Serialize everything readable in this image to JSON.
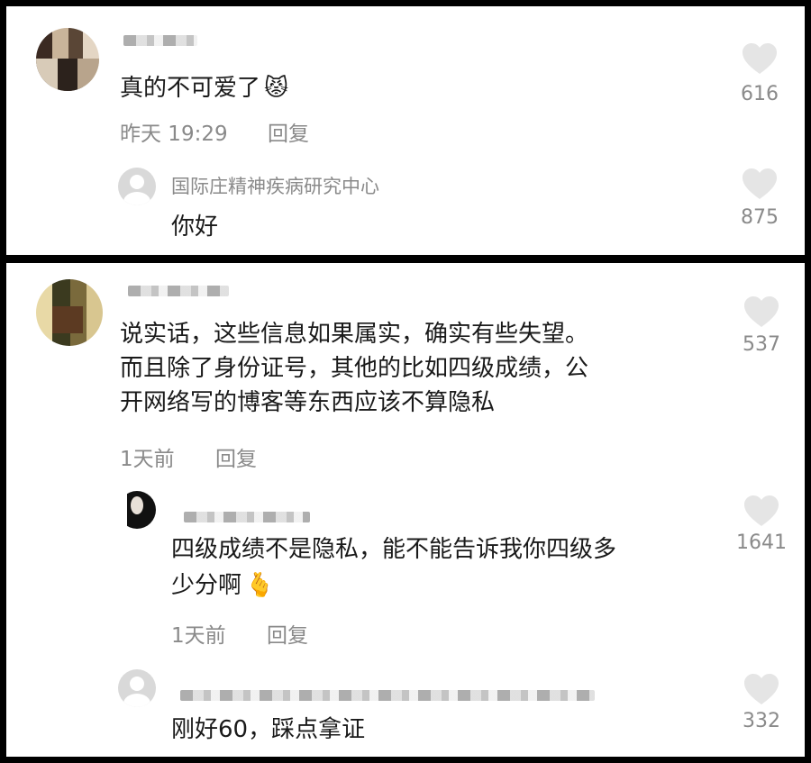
{
  "panel1": {
    "comment": {
      "text": "真的不可爱了",
      "emoji": "😾",
      "time": "昨天 19:29",
      "reply": "回复",
      "likes": "616"
    },
    "reply": {
      "username": "国际庄精神疾病研究中心",
      "text": "你好",
      "likes": "875"
    }
  },
  "panel2": {
    "comment": {
      "line1": "说实话，这些信息如果属实，确实有些失望。",
      "line2": "而且除了身份证号，其他的比如四级成绩，公",
      "line3": "开网络写的博客等东西应该不算隐私",
      "time": "1天前",
      "reply": "回复",
      "likes": "537"
    },
    "reply1": {
      "line1": "四级成绩不是隐私，能不能告诉我你四级多",
      "line2": "少分啊",
      "emoji": "🫰",
      "time": "1天前",
      "reply": "回复",
      "likes": "1641"
    },
    "reply2": {
      "text": "刚好60，踩点拿证",
      "likes": "332"
    }
  },
  "icons": {
    "like": "heart-icon",
    "default_avatar": "default-avatar-icon"
  },
  "colors": {
    "text": "#1a1a1a",
    "meta": "#8a8a8a",
    "heart": "#e5e5e5"
  }
}
